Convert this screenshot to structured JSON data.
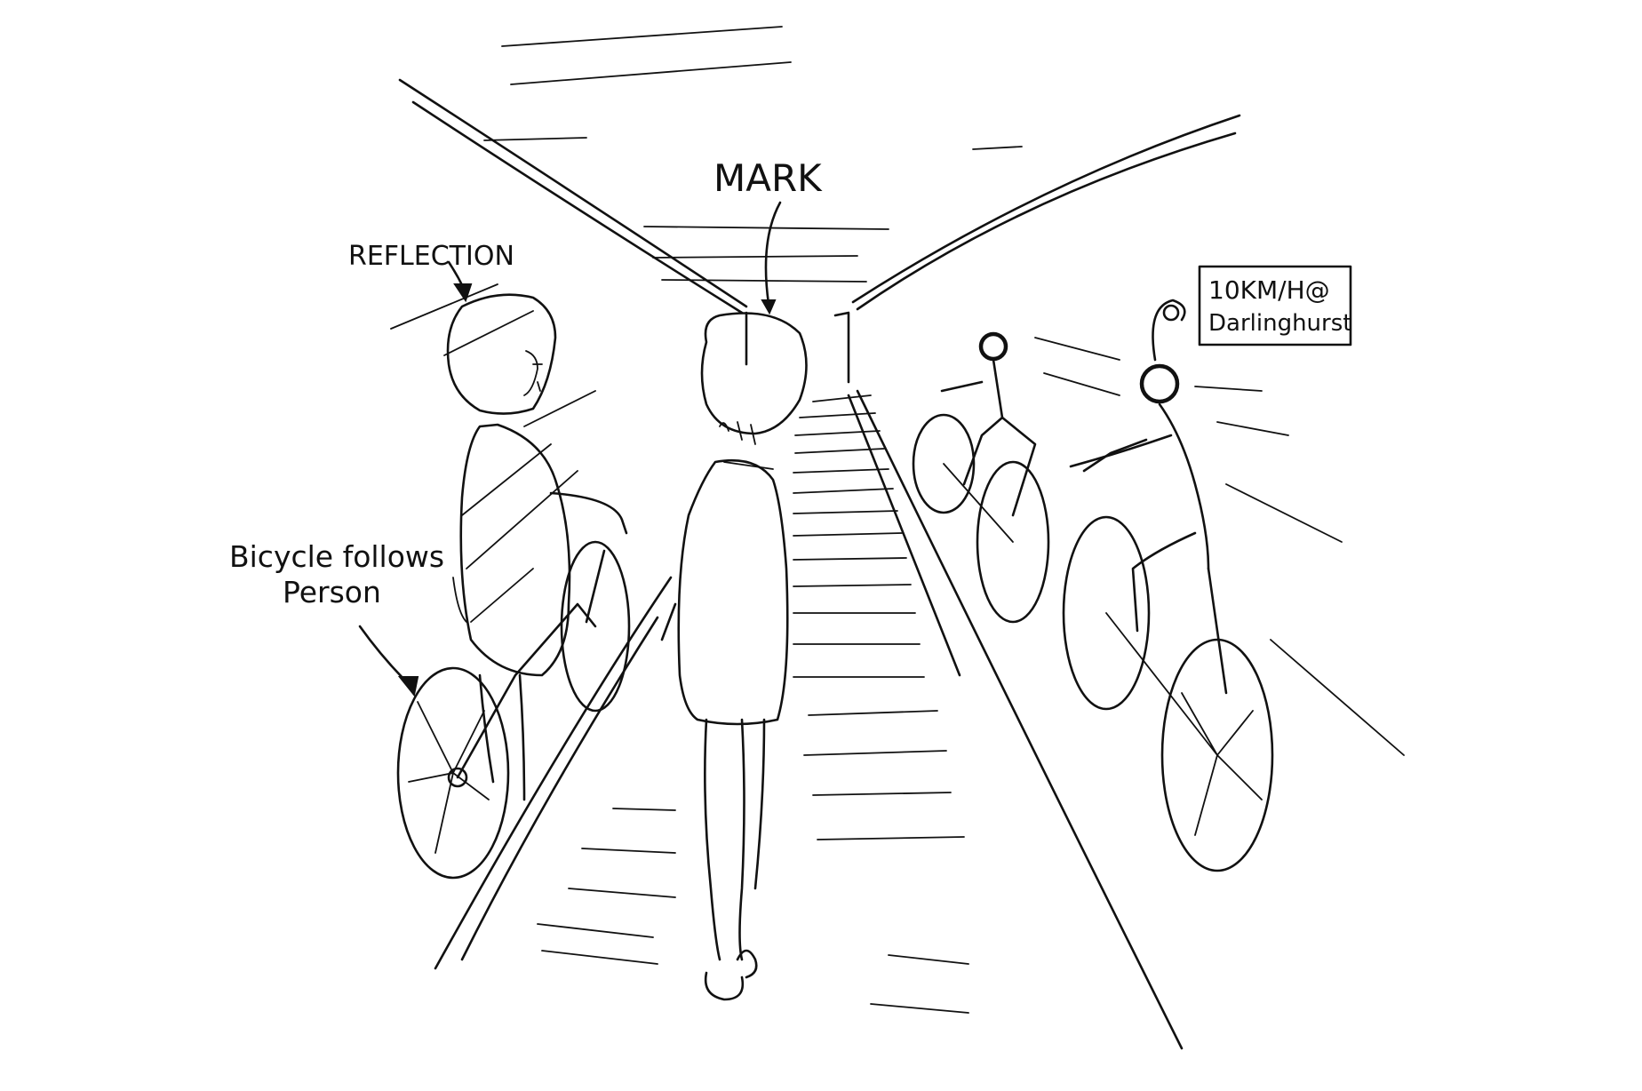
{
  "annotations": {
    "mark": "MARK",
    "reflection": "REFLECTION",
    "bicycle_follows_line1": "Bicycle follows",
    "bicycle_follows_line2": "Person",
    "speed_line1": "10KM/H@",
    "speed_line2": "Darlinghurst"
  },
  "ink_color": "#111111",
  "paper_color": "#ffffff"
}
